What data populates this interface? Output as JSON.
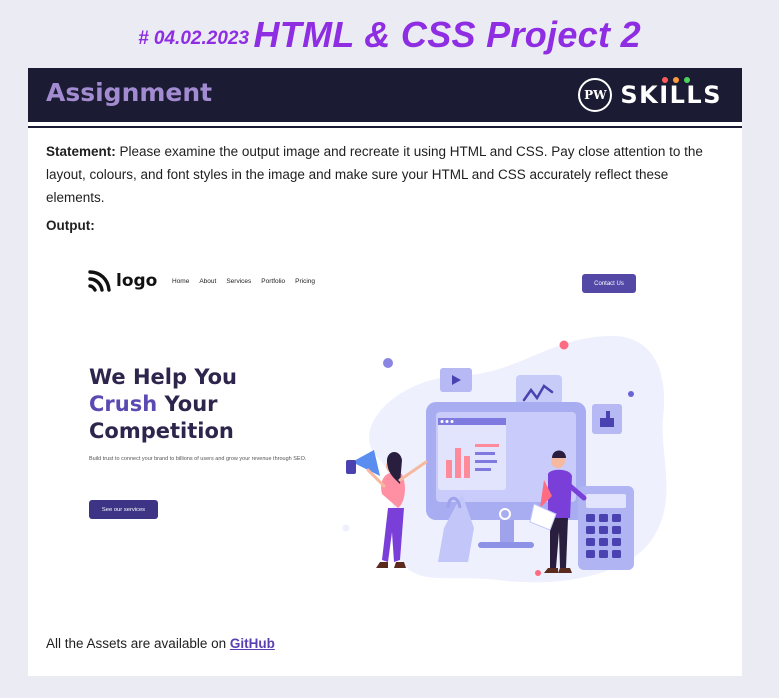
{
  "header": {
    "date": "# 04.02.2023",
    "title": "HTML & CSS Project 2"
  },
  "banner": {
    "title": "Assignment",
    "badge_text": "PW",
    "brand": "SKILLS"
  },
  "statement": {
    "label": "Statement:",
    "text": " Please examine the output image and recreate it using HTML and CSS. Pay close attention to the layout, colours, and font styles in the image and make sure your HTML and CSS accurately reflect these elements."
  },
  "output_label": "Output:",
  "mockup": {
    "logo": "logo",
    "nav": [
      "Home",
      "About",
      "Services",
      "Portfolio",
      "Pricing"
    ],
    "contact": "Contact Us",
    "hero_line1": "We Help You",
    "hero_accent": "Crush",
    "hero_line2_rest": " Your",
    "hero_line3": "Competition",
    "sub": "Build trust to connect your brand to billions of users and grow your revenue through SEO.",
    "cta": "See our services"
  },
  "footer": {
    "text": "All the Assets are available on ",
    "link": "GitHub"
  },
  "colors": {
    "title": "#8e2de2",
    "banner": "#1b1c33",
    "banner_title": "#a28bd0",
    "mock_button": "#5348a6",
    "hero_dark": "#2e254d",
    "hero_accent": "#5a4ab2",
    "dot_red": "#ff5a5a",
    "dot_orange": "#ff9a3c",
    "dot_green": "#4cd35a"
  },
  "icons": [
    "pw-logo-icon",
    "logo-mark-icon",
    "illustration"
  ]
}
